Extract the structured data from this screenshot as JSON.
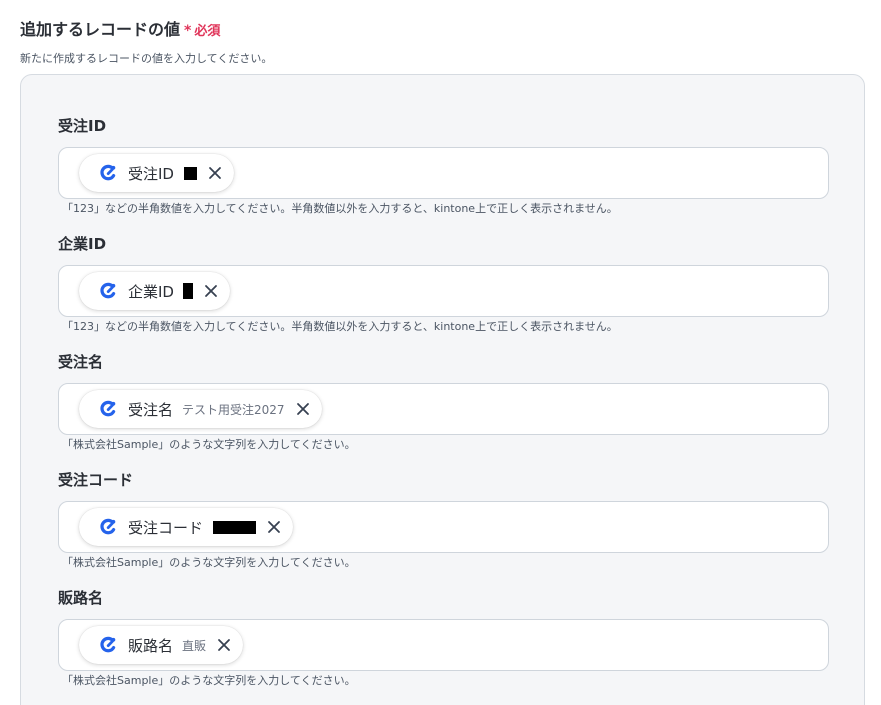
{
  "section": {
    "title": "追加するレコードの値",
    "required_mark": "*",
    "required_text": "必須",
    "description": "新たに作成するレコードの値を入力してください。"
  },
  "fields": [
    {
      "label": "受注ID",
      "chip_label": "受注ID",
      "sample": "",
      "hint": "「123」などの半角数値を入力してください。半角数値以外を入力すると、kintone上で正しく表示されません。"
    },
    {
      "label": "企業ID",
      "chip_label": "企業ID",
      "sample": "",
      "hint": "「123」などの半角数値を入力してください。半角数値以外を入力すると、kintone上で正しく表示されません。"
    },
    {
      "label": "受注名",
      "chip_label": "受注名",
      "sample": "テスト用受注2027",
      "hint": "「株式会社Sample」のような文字列を入力してください。"
    },
    {
      "label": "受注コード",
      "chip_label": "受注コード",
      "sample": "",
      "hint": "「株式会社Sample」のような文字列を入力してください。"
    },
    {
      "label": "販路名",
      "chip_label": "販路名",
      "sample": "直販",
      "hint": "「株式会社Sample」のような文字列を入力してください。"
    }
  ],
  "icons": {
    "chip": "app-logo-icon",
    "remove": "close-icon"
  },
  "colors": {
    "required": "#e0355a",
    "app_logo": "#2563eb",
    "panel_bg": "#f5f6f8"
  }
}
